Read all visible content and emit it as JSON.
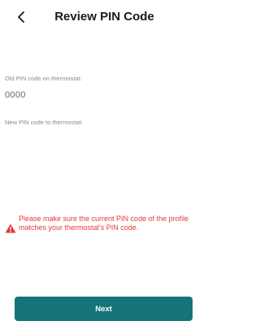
{
  "header": {
    "title": "Review PIN Code",
    "back_icon": "chevron-left-icon"
  },
  "old_pin": {
    "label": "Old PIN code on thermostat:",
    "value": "0000"
  },
  "new_pin": {
    "label": "New PIN code to thermostat:"
  },
  "warning": {
    "icon": "warning-triangle-icon",
    "text": "Please make sure the current PIN code of the profile matches your thermostat's PIN code.",
    "color": "#e53935"
  },
  "actions": {
    "next_label": "Next",
    "accent_color": "#157479"
  }
}
